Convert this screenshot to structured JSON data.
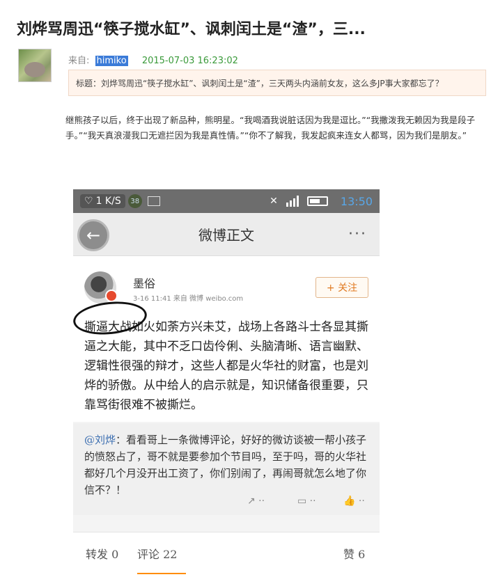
{
  "article": {
    "title": "刘烨骂周迅“筷子搅水缸”、讽刺闰土是“渣”，三...",
    "meta_from_label": "来自:",
    "meta_user": "himiko",
    "meta_date": "2015-07-03 16:23:02",
    "quote": "标题：刘烨骂周迅“筷子搅水缸”、讽刺闰土是“渣”，三天两头内涵前女友，这么多JP事大家都忘了？",
    "body": "继熊孩子以后，终于出现了新品种，熊明星。“我喝酒我说脏话因为我是逗比。”“我撒泼我无赖因为我是段子手。”“我天真浪漫我口无遮拦因为我是真性情。”“你不了解我，我发起疯来连女人都骂，因为我们是朋友。”"
  },
  "phone": {
    "statusbar": {
      "speed": "1 K/S",
      "badge": "38",
      "time": "13:50"
    },
    "navbar": {
      "back_icon": "back-arrow-icon",
      "title": "微博正文",
      "more": "···"
    },
    "post": {
      "author": "墨俗",
      "meta": "3-16 11:41  来自 微博 weibo.com",
      "follow": "+ 关注",
      "text": "撕逼大战如火如荼方兴未艾，战场上各路斗士各显其撕逼之大能，其中不乏口齿伶俐、头脑清晰、语言幽默、逻辑性很强的辩才，这些人都是火华社的财富，也是刘烨的骄傲。从中给人的启示就是，知识储备很重要，只靠骂街很难不被撕烂。"
    },
    "repost": {
      "mention": "@刘烨",
      "text": "：看看哥上一条微博评论，好好的微访谈被一帮小孩子的愤怒占了，哥不就是要参加个节目吗，至于吗，哥的火华社都好几个月没开出工资了，你们别闹了，再闹哥就怎么地了你信不？！",
      "action_share": "↗ ··",
      "action_comment": "▭ ··",
      "action_like": "👍 ··"
    },
    "bottom": {
      "repost": "转发 0",
      "comment": "评论 22",
      "like": "赞 6"
    }
  }
}
